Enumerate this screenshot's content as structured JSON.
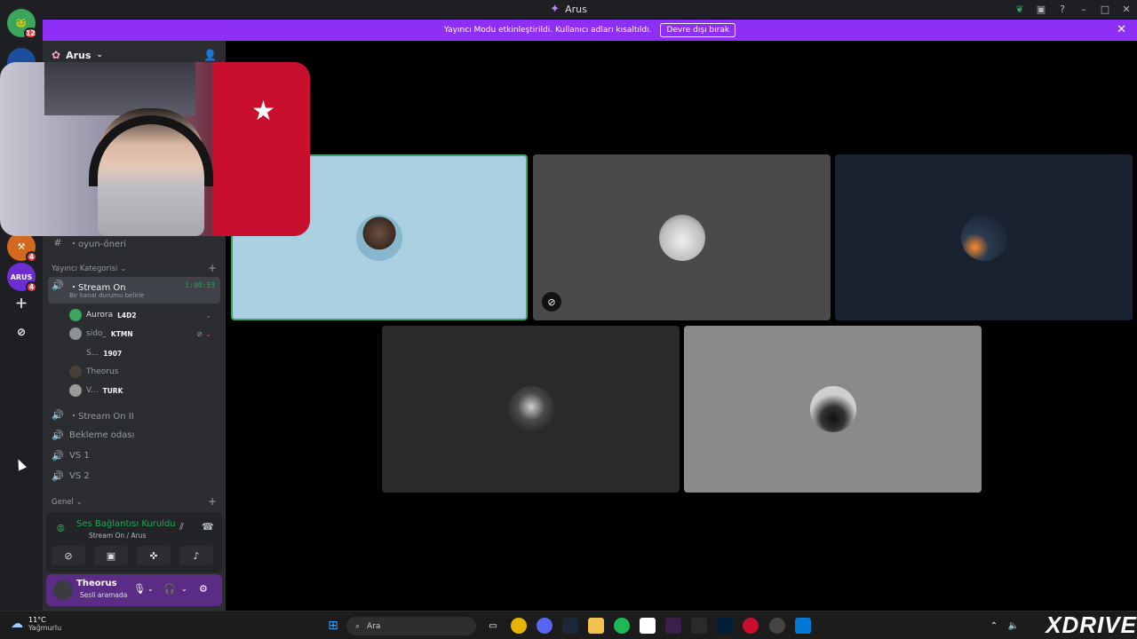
{
  "window": {
    "title": "Arus"
  },
  "banner": {
    "message": "Yayıncı Modu etkinleştirildi. Kullanıcı adları kısaltıldı.",
    "button": "Devre dışı bırak"
  },
  "rail": {
    "top_badge": "12",
    "arus_badge": "4",
    "arus_label": "ARUS",
    "other_badge": "4"
  },
  "guild": {
    "name": "Arus"
  },
  "channels": {
    "text_channel": "・oyun-öneri",
    "category_streamer": "Yayıncı Kategorisi",
    "active_voice": {
      "name": "・Stream On",
      "timer": "1:00:53",
      "sub": "Bir kanal durumu belirle"
    },
    "voice_users": [
      {
        "name": "Aurora",
        "tag": "L4D2"
      },
      {
        "name": "sido_",
        "tag": "KTMN"
      },
      {
        "name": "S...",
        "tag": "1907"
      },
      {
        "name": "Theorus",
        "tag": ""
      },
      {
        "name": "V...",
        "tag": "TURK"
      }
    ],
    "other_voice": [
      "・Stream On II",
      "Bekleme odası",
      "VS 1",
      "VS 2"
    ],
    "category_general": "Genel"
  },
  "voice_panel": {
    "status": "Ses Bağlantısı Kuruldu",
    "location": "Stream On / Arus"
  },
  "user_panel": {
    "name": "Theorus",
    "status": "Sesli aramada"
  },
  "taskbar": {
    "temperature": "11°C",
    "weather": "Yağmurlu",
    "search": "Ara",
    "brand": "XDRIVE"
  },
  "icons": {
    "titlebar": [
      "leaf-icon",
      "inbox-icon",
      "help-icon",
      "minimize-icon",
      "maximize-icon",
      "close-icon"
    ],
    "voice_controls": [
      "camera-off-icon",
      "screen-share-icon",
      "activities-icon",
      "soundboard-icon"
    ]
  },
  "colors": {
    "accent": "#8e2ff5",
    "connected": "#23a559",
    "speaking_border": "#3ba55c"
  }
}
